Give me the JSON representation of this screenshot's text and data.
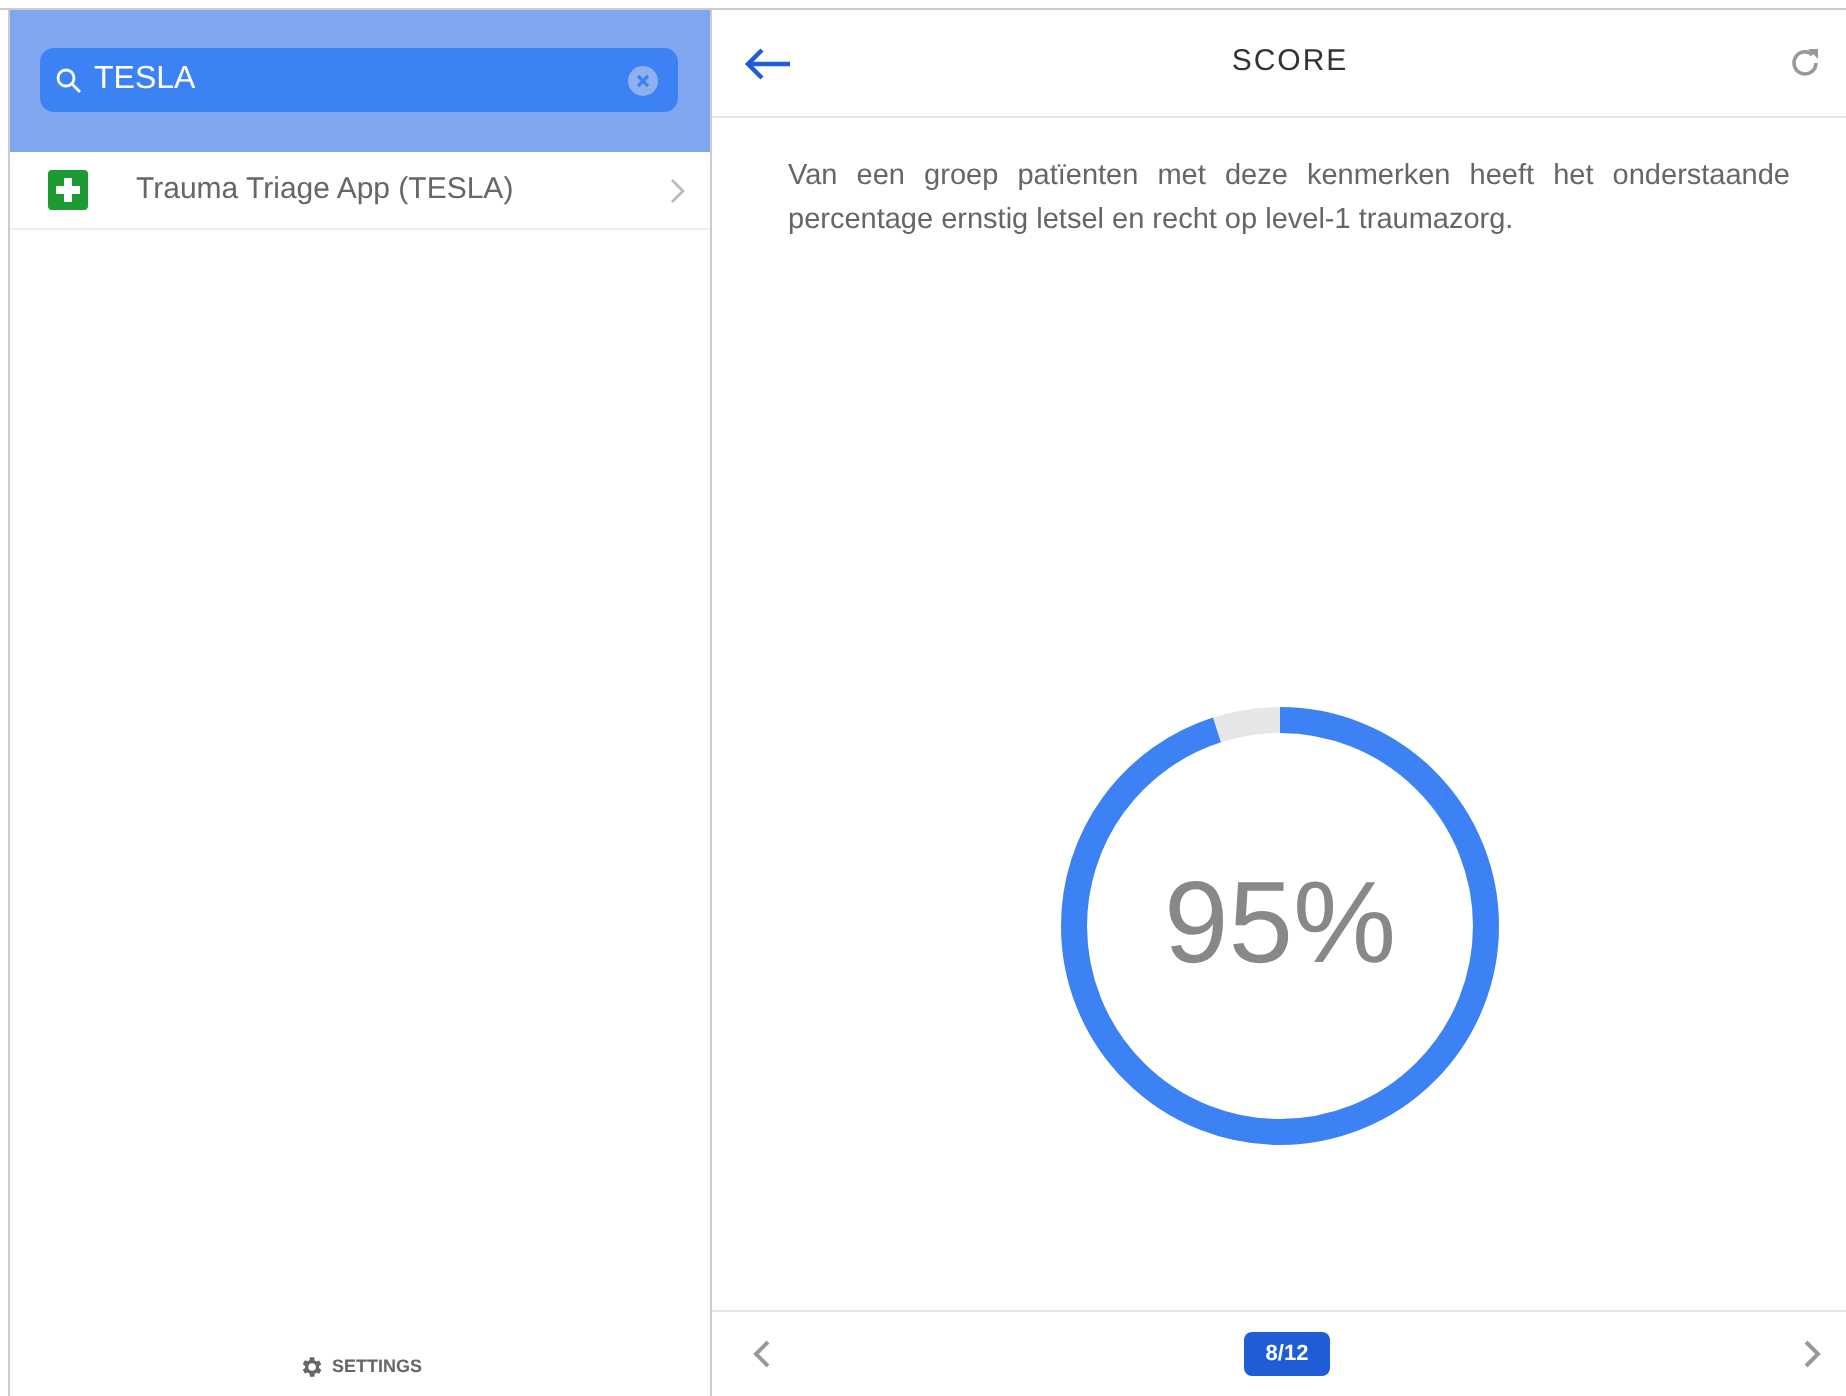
{
  "search": {
    "value": "TESLA"
  },
  "results": [
    {
      "label": "Trauma Triage App (TESLA)"
    }
  ],
  "settings": {
    "label": "SETTINGS"
  },
  "header": {
    "title": "SCORE"
  },
  "description": "Van een groep patïenten met deze kenmerken heeft het onderstaande percentage ernstig letsel en recht op level-1 traumazorg.",
  "score": {
    "reading": "95%",
    "level": 0.95
  },
  "pager": {
    "label": "8/12"
  }
}
